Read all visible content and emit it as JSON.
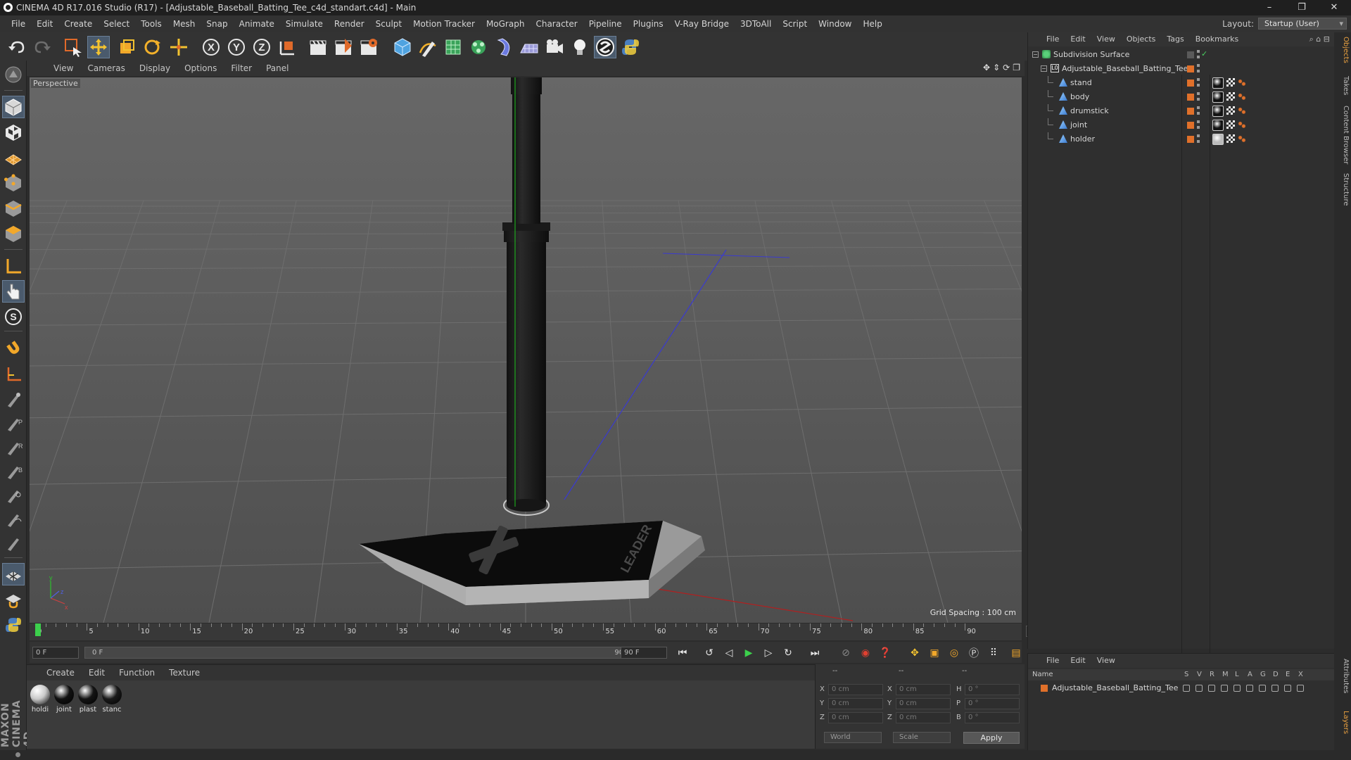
{
  "window": {
    "title": "CINEMA 4D R17.016 Studio (R17) - [Adjustable_Baseball_Batting_Tee_c4d_standart.c4d] - Main",
    "min": "–",
    "restore": "❐",
    "close": "✕"
  },
  "menu": [
    "File",
    "Edit",
    "Create",
    "Select",
    "Tools",
    "Mesh",
    "Snap",
    "Animate",
    "Simulate",
    "Render",
    "Sculpt",
    "Motion Tracker",
    "MoGraph",
    "Character",
    "Pipeline",
    "Plugins",
    "V-Ray Bridge",
    "3DToAll",
    "Script",
    "Window",
    "Help"
  ],
  "layout": {
    "label": "Layout:",
    "value": "Startup (User)"
  },
  "viewport": {
    "menu": [
      "View",
      "Cameras",
      "Display",
      "Options",
      "Filter",
      "Panel"
    ],
    "label": "Perspective",
    "grid_spacing": "Grid Spacing : 100 cm"
  },
  "timeline": {
    "ticks": [
      "0",
      "5",
      "10",
      "15",
      "20",
      "25",
      "30",
      "35",
      "40",
      "45",
      "50",
      "55",
      "60",
      "65",
      "70",
      "75",
      "80",
      "85",
      "90"
    ],
    "current_frame": "0 F"
  },
  "transport": {
    "start": "0 F",
    "range_start": "0 F",
    "range_end": "90 F",
    "end": "90 F"
  },
  "materials": {
    "menu": [
      "Create",
      "Edit",
      "Function",
      "Texture"
    ],
    "items": [
      {
        "name": "holdi",
        "color": "#c9c9c9"
      },
      {
        "name": "joint",
        "color": "#111111"
      },
      {
        "name": "plast",
        "color": "#141414"
      },
      {
        "name": "stanc",
        "color": "#1a1a1a"
      }
    ]
  },
  "coords": {
    "headers": [
      "--",
      "--",
      "--"
    ],
    "rows": [
      {
        "a": "X",
        "av": "0 cm",
        "b": "X",
        "bv": "0 cm",
        "c": "H",
        "cv": "0 °"
      },
      {
        "a": "Y",
        "av": "0 cm",
        "b": "Y",
        "bv": "0 cm",
        "c": "P",
        "cv": "0 °"
      },
      {
        "a": "Z",
        "av": "0 cm",
        "b": "Z",
        "bv": "0 cm",
        "c": "B",
        "cv": "0 °"
      }
    ],
    "mode": "World",
    "scale": "Scale",
    "apply": "Apply"
  },
  "objects": {
    "menu": [
      "File",
      "Edit",
      "View",
      "Objects",
      "Tags",
      "Bookmarks"
    ],
    "tree": [
      {
        "name": "Subdivision Surface",
        "level": 0
      },
      {
        "name": "Adjustable_Baseball_Batting_Tee",
        "level": 1
      },
      {
        "name": "stand",
        "level": 2
      },
      {
        "name": "body",
        "level": 2
      },
      {
        "name": "drumstick",
        "level": 2
      },
      {
        "name": "joint",
        "level": 2
      },
      {
        "name": "holder",
        "level": 2
      }
    ],
    "accent": "#e0702a"
  },
  "layers": {
    "menu": [
      "File",
      "Edit",
      "View"
    ],
    "columns": {
      "name": "Name",
      "flags": [
        "S",
        "V",
        "R",
        "M",
        "L",
        "A",
        "G",
        "D",
        "E",
        "X"
      ]
    },
    "rows": [
      {
        "name": "Adjustable_Baseball_Batting_Tee"
      }
    ]
  },
  "sidetabs": [
    "Objects",
    "Takes",
    "Content Browser",
    "Structure",
    "Attributes",
    "Layers"
  ],
  "brand": "MAXON CINEMA 4D"
}
